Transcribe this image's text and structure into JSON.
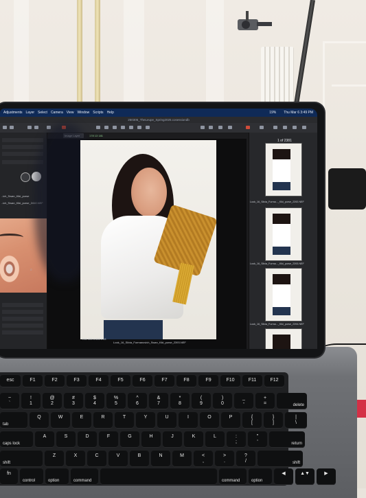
{
  "menubar": {
    "items": [
      "Adjustments",
      "Layer",
      "Select",
      "Camera",
      "View",
      "Window",
      "Scripts",
      "Help"
    ],
    "battery": "19%",
    "datetime": "Thu Mar 6  3:49 PM"
  },
  "titlebar": {
    "title": "250306_TheLeupe_Spring2025.cosessiondb"
  },
  "toolbar": {
    "layer_select": "Image Layer",
    "counts": "178  13  181"
  },
  "left_panel": {
    "labels": [
      "..ich_Swan_Kiki_purse",
      "..ich_Swan_Kiki_purse_2410.NEF"
    ],
    "search_icon": "search-icon"
  },
  "viewer": {
    "status": "ISO 100     1/160 s     f/8",
    "caption": "Look_16_Silvia_Furmanovich_Swan_Kiki_purse_2393.NEF"
  },
  "browser": {
    "count": "1 of 2381",
    "thumbnails": [
      {
        "label": "Look_16_Silvia_Furma..._Kiki_purse_2392.NEF"
      },
      {
        "label": "Look_16_Silvia_Furma..._Kiki_purse_2393.NEF"
      },
      {
        "label": "Look_16_Silvia_Furma..._Kiki_purse_2394.NEF"
      }
    ]
  },
  "keyboard": {
    "rows": [
      [
        "esc",
        "F1",
        "F2",
        "F3",
        "F4",
        "F5",
        "F6",
        "F7",
        "F8",
        "F9",
        "F10",
        "F11",
        "F12"
      ],
      [
        "~ `",
        "! 1",
        "@ 2",
        "# 3",
        "$ 4",
        "% 5",
        "^ 6",
        "& 7",
        "* 8",
        "( 9",
        ") 0",
        "_ -",
        "+ =",
        "delete"
      ],
      [
        "tab",
        "Q",
        "W",
        "E",
        "R",
        "T",
        "Y",
        "U",
        "I",
        "O",
        "P",
        "{ [",
        "} ]",
        "| \\"
      ],
      [
        "caps lock",
        "A",
        "S",
        "D",
        "F",
        "G",
        "H",
        "J",
        "K",
        "L",
        ": ;",
        "\" '",
        "return"
      ],
      [
        "shift",
        "Z",
        "X",
        "C",
        "V",
        "B",
        "N",
        "M",
        "< ,",
        "> .",
        "? /",
        "shift"
      ],
      [
        "fn",
        "control",
        "option",
        "command",
        "",
        "command",
        "option",
        "◀",
        "▲▼",
        "▶"
      ]
    ]
  },
  "colors": {
    "menubar": "#0f2a57",
    "accent_red": "#d43046",
    "purse": "#c9902e"
  }
}
